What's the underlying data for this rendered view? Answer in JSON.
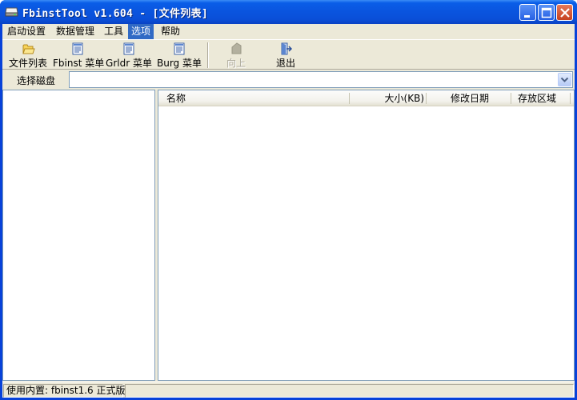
{
  "window": {
    "title": "FbinstTool v1.604 - [文件列表]"
  },
  "menu": [
    {
      "label": "启动设置"
    },
    {
      "label": "数据管理"
    },
    {
      "label": "工具"
    },
    {
      "label": "选项",
      "active": true
    },
    {
      "label": "帮助"
    }
  ],
  "toolbar": {
    "file_list": "文件列表",
    "fbinst_menu": "Fbinst 菜单",
    "grldr_menu": "Grldr 菜单",
    "burg_menu": "Burg 菜单",
    "up": "向上",
    "exit": "退出"
  },
  "disk": {
    "label": "选择磁盘",
    "value": ""
  },
  "list": {
    "columns": [
      "名称",
      "大小(KB)",
      "修改日期",
      "存放区域"
    ]
  },
  "status": {
    "text": "使用内置: fbinst1.6 正式版"
  },
  "colors": {
    "titlebar": "#0a55df",
    "face": "#ece9d8",
    "menu_highlight": "#316ac5",
    "close_button": "#c6411f"
  },
  "icons": {
    "app": "usb-drive-icon",
    "file_list": "folder-open-icon",
    "menu_doc": "document-icon",
    "up": "up-arrow-icon",
    "exit": "exit-door-icon"
  }
}
